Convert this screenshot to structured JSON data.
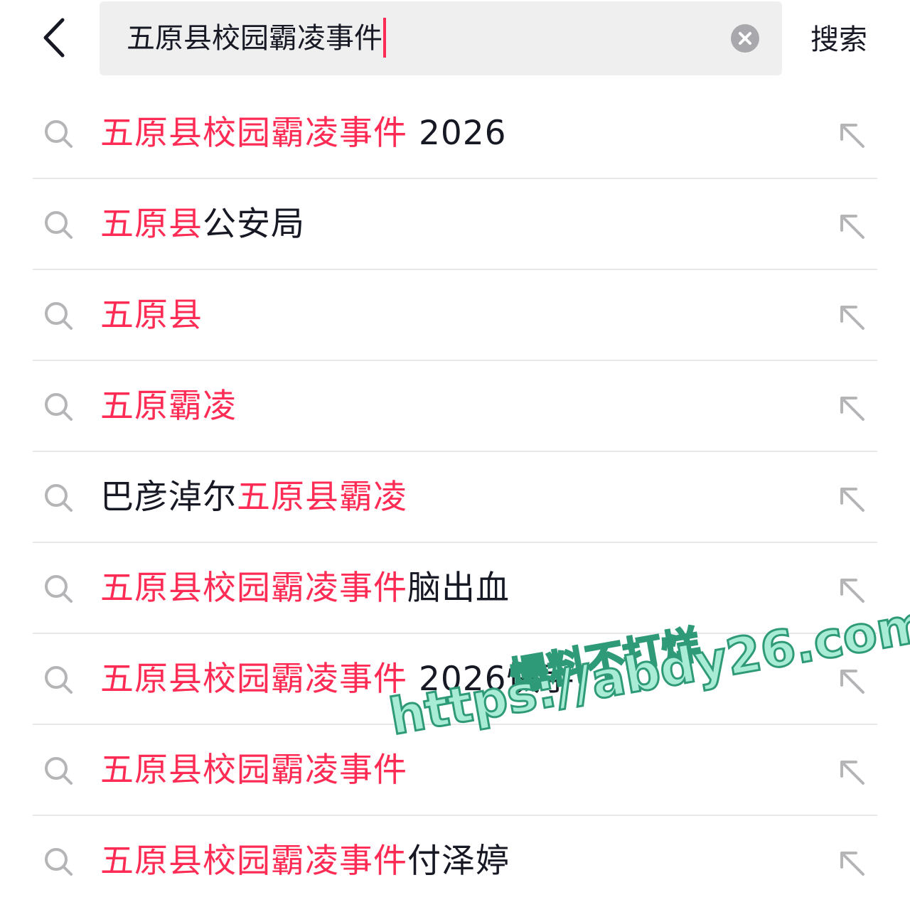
{
  "header": {
    "query": "五原县校园霸凌事件",
    "search_label": "搜索"
  },
  "suggestions": [
    {
      "highlight": "五原县校园霸凌事件",
      "rest": " 2026",
      "highlight_first": true
    },
    {
      "highlight": "五原县",
      "rest": "公安局",
      "highlight_first": true
    },
    {
      "highlight": "五原县",
      "rest": "",
      "highlight_first": true
    },
    {
      "highlight": "五原霸凌",
      "rest": "",
      "highlight_first": true
    },
    {
      "highlight": "五原县霸凌",
      "rest": "巴彦淖尔",
      "highlight_first": false
    },
    {
      "highlight": "五原县校园霸凌事件",
      "rest": "脑出血",
      "highlight_first": true
    },
    {
      "highlight": "五原县校园霸凌事件",
      "rest": " 2026快手",
      "highlight_first": true
    },
    {
      "highlight": "五原县校园霸凌事件",
      "rest": "",
      "highlight_first": true
    },
    {
      "highlight": "五原县校园霸凌事件",
      "rest": "付泽婷",
      "highlight_first": true
    }
  ],
  "watermark": {
    "line1": "爆料不打烊",
    "line2": "https://abdy26.com"
  },
  "colors": {
    "accent": "#fe2c55",
    "text": "#161823",
    "search_bg": "#efeff0",
    "divider": "#e7e7e9",
    "icon_gray": "#b5b5b8"
  },
  "icons": {
    "back": "chevron-left-icon",
    "clear": "clear-circle-icon",
    "suggestion": "search-icon",
    "fill": "arrow-up-left-icon"
  }
}
